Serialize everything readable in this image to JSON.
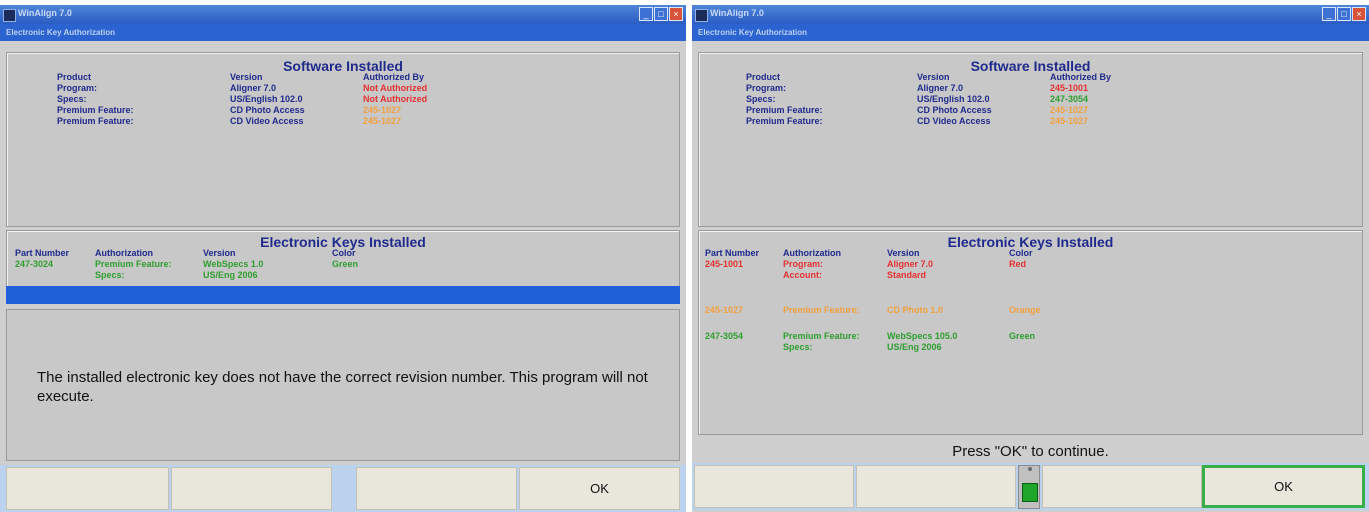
{
  "left": {
    "title": "WinAlign 7.0",
    "subtitle": "Electronic Key Authorization",
    "software": {
      "title": "Software Installed",
      "headers": [
        "Product",
        "Version",
        "Authorized By"
      ],
      "rows": [
        {
          "product": "Program:",
          "version": "Aligner 7.0",
          "auth": "Not Authorized"
        },
        {
          "product": "Specs:",
          "version": "US/English 102.0",
          "auth": "Not Authorized"
        },
        {
          "product": "Premium Feature:",
          "version": "CD Photo Access",
          "auth": "245-1027"
        },
        {
          "product": "Premium Feature:",
          "version": "CD Video Access",
          "auth": "245-1027"
        }
      ]
    },
    "keys": {
      "title": "Electronic Keys Installed",
      "headers": [
        "Part Number",
        "Authorization",
        "Version",
        "Color"
      ],
      "row": {
        "part": "247-3024",
        "auth1": "Premium Feature:",
        "auth2": "Specs:",
        "ver1": "WebSpecs 1.0",
        "ver2": "US/Eng 2006",
        "color": "Green"
      }
    },
    "message": "The installed electronic key does not have the correct revision number. This program will not execute.",
    "buttons": [
      "",
      "",
      "",
      "OK"
    ]
  },
  "right": {
    "title": "WinAlign 7.0",
    "subtitle": "Electronic Key Authorization",
    "software": {
      "title": "Software Installed",
      "headers": [
        "Product",
        "Version",
        "Authorized By"
      ],
      "rows": [
        {
          "product": "Program:",
          "version": "Aligner 7.0",
          "auth": "245-1001"
        },
        {
          "product": "Specs:",
          "version": "US/English 102.0",
          "auth": "247-3054"
        },
        {
          "product": "Premium Feature:",
          "version": "CD Photo Access",
          "auth": "245-1027"
        },
        {
          "product": "Premium Feature:",
          "version": "CD Video Access",
          "auth": "245-1027"
        }
      ]
    },
    "keys": {
      "title": "Electronic Keys Installed",
      "headers": [
        "Part Number",
        "Authorization",
        "Version",
        "Color"
      ],
      "rows": [
        {
          "part": "245-1001",
          "auth1": "Program:",
          "auth2": "Account:",
          "ver1": "Aligner 7.0",
          "ver2": "Standard",
          "color": "Red"
        },
        {
          "part": "245-1027",
          "auth1": "Premium Feature:",
          "auth2": "",
          "ver1": "CD Photo 1.0",
          "ver2": "",
          "color": "Orange"
        },
        {
          "part": "247-3054",
          "auth1": "Premium Feature:",
          "auth2": "Specs:",
          "ver1": "WebSpecs 105.0",
          "ver2": "US/Eng 2006",
          "color": "Green"
        }
      ]
    },
    "prompt": "Press \"OK\" to continue.",
    "buttons": [
      "",
      "",
      "",
      "OK"
    ],
    "slider_level": 0.4
  },
  "colors": {
    "title_bar": "#2b63d0",
    "panel": "#c8c8c8",
    "heading": "#1f2a8c",
    "red": "#e53131",
    "orange": "#f3a03e",
    "green": "#2f9e2f",
    "ok_highlight": "#38b04a"
  }
}
